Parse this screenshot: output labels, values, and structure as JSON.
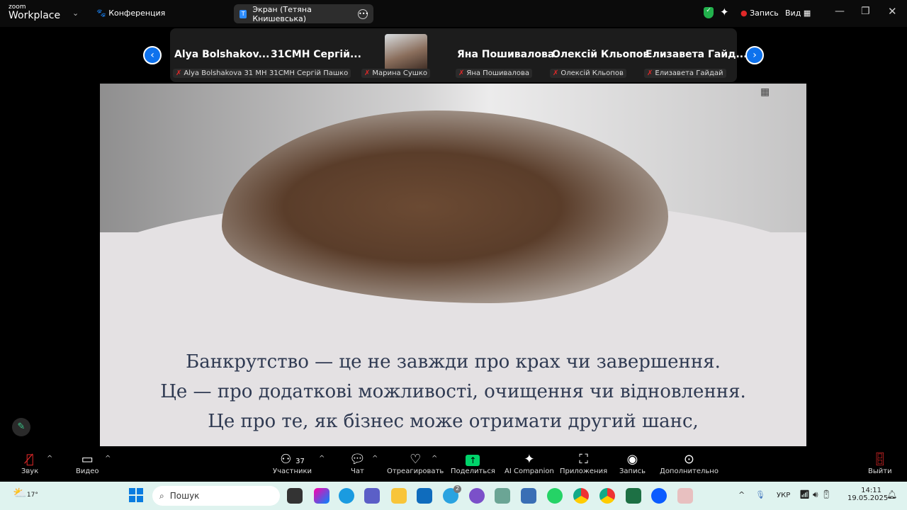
{
  "app": {
    "logo_small": "zoom",
    "logo_big": "Workplace",
    "meeting_label": "Конференция",
    "share_title": "Экран (Тетяна Книшевська)",
    "share_badge": "T",
    "record_indicator": "Запись",
    "view_label": "Вид"
  },
  "participants": [
    {
      "display": "Alya  Bolshakov...",
      "label": "Alya Bolshakova 31 MH",
      "muted": true
    },
    {
      "display": "31CMH  Сергій...",
      "label": "31CMH Сергій Пашко",
      "muted": false
    },
    {
      "display": "",
      "label": "Марина Сушко",
      "muted": true
    },
    {
      "display": "Яна Пошивалова",
      "label": "Яна Пошивалова",
      "muted": true
    },
    {
      "display": "Олексій Кльопов",
      "label": "Олексій Кльопов",
      "muted": true
    },
    {
      "display": "Елизавета  Гайд...",
      "label": "Елизавета Гайдай",
      "muted": true
    }
  ],
  "slide": {
    "lines": [
      "Банкрутство — це не завжди про крах чи завершення.",
      "Це — про додаткові можливості, очищення чи відновлення.",
      "Це про те, як бізнес може отримати другий шанс,"
    ]
  },
  "toolbar": {
    "audio": "Звук",
    "video": "Видео",
    "participants": "Участники",
    "participants_count": "37",
    "chat": "Чат",
    "react": "Отреагировать",
    "share": "Поделиться",
    "ai": "AI Companion",
    "apps": "Приложения",
    "record": "Запись",
    "more": "Дополнительно",
    "leave": "Выйти"
  },
  "taskbar": {
    "weather": "17°",
    "search_placeholder": "Пошук",
    "lang": "УКР",
    "time": "14:11",
    "date": "19.05.2025",
    "telegram_badge": "2"
  },
  "colors": {
    "accent": "#0e72ed",
    "share_green": "#00d36a",
    "slide_text": "#2f3a52"
  }
}
